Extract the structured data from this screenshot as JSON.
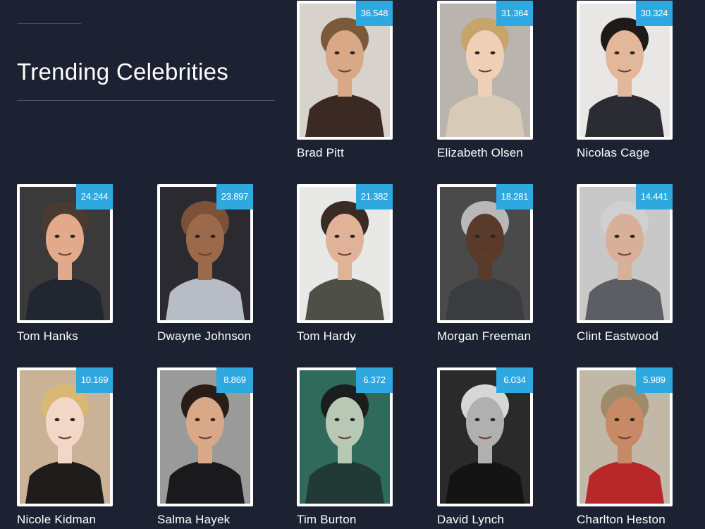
{
  "page": {
    "title": "Trending Celebrities",
    "background_color": "#1d2233",
    "badge_color": "#2fa8e0"
  },
  "celebrities": [
    {
      "name": "Brad Pitt",
      "score": "36.548",
      "bg": "#d8d2cc",
      "skin": "#d9a887",
      "hair": "#7a5a3a",
      "shirt": "#3b2a24"
    },
    {
      "name": "Elizabeth Olsen",
      "score": "31.364",
      "bg": "#b9b4ad",
      "skin": "#f0cfb7",
      "hair": "#c6a46a",
      "shirt": "#d7cbb8"
    },
    {
      "name": "Nicolas Cage",
      "score": "30.324",
      "bg": "#e9e7e5",
      "skin": "#e3b79a",
      "hair": "#1e1a18",
      "shirt": "#2a2b33"
    },
    {
      "name": "Tom Hanks",
      "score": "24.244",
      "bg": "#3a3a3a",
      "skin": "#e2a98a",
      "hair": "#4a3a30",
      "shirt": "#222630"
    },
    {
      "name": "Dwayne Johnson",
      "score": "23.897",
      "bg": "#2a2a30",
      "skin": "#9c6a4a",
      "hair": "#7d5038",
      "shirt": "#b8bcc4"
    },
    {
      "name": "Tom Hardy",
      "score": "21.382",
      "bg": "#e8e8e6",
      "skin": "#e0b298",
      "hair": "#3a2c24",
      "shirt": "#4e5048"
    },
    {
      "name": "Morgan Freeman",
      "score": "18.281",
      "bg": "#4a4a4a",
      "skin": "#5a3a2a",
      "hair": "#b8b8b8",
      "shirt": "#3a3c40"
    },
    {
      "name": "Clint Eastwood",
      "score": "14.441",
      "bg": "#c8c8c8",
      "skin": "#d8b09a",
      "hair": "#d0d0d0",
      "shirt": "#5c5e64"
    },
    {
      "name": "Nicole Kidman",
      "score": "10.169",
      "bg": "#c9b296",
      "skin": "#f2d6c6",
      "hair": "#d8b872",
      "shirt": "#1f1c1c"
    },
    {
      "name": "Salma Hayek",
      "score": "8.869",
      "bg": "#9a9a9a",
      "skin": "#d8a888",
      "hair": "#2a1c16",
      "shirt": "#1a1a1c"
    },
    {
      "name": "Tim Burton",
      "score": "6.372",
      "bg": "#2f6a5a",
      "skin": "#b8c8b4",
      "hair": "#1a1f1e",
      "shirt": "#223a34"
    },
    {
      "name": "David Lynch",
      "score": "6.034",
      "bg": "#2a2a2a",
      "skin": "#b0b0b0",
      "hair": "#d6d6d6",
      "shirt": "#141414"
    },
    {
      "name": "Charlton Heston",
      "score": "5.989",
      "bg": "#c2b8a8",
      "skin": "#c88a66",
      "hair": "#a08a6c",
      "shirt": "#b8282a"
    }
  ]
}
